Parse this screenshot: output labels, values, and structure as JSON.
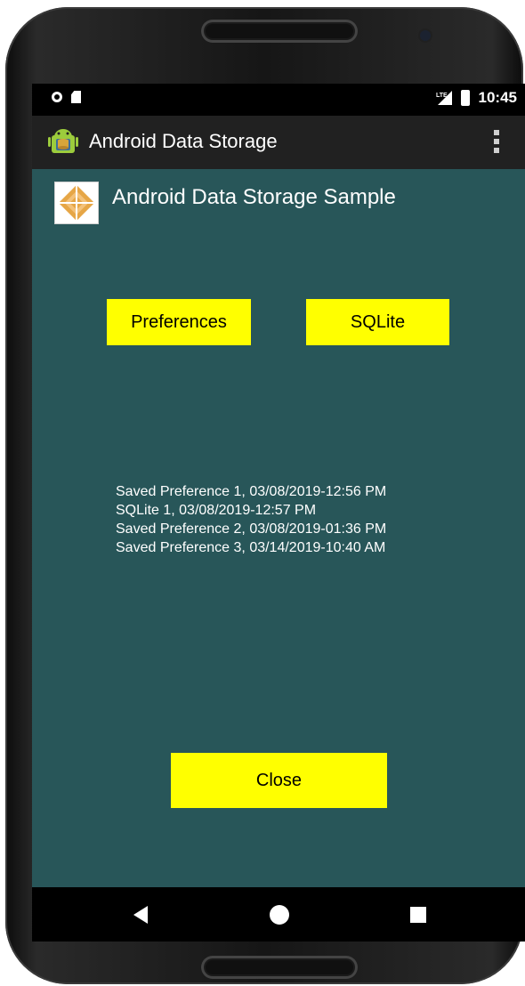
{
  "status_bar": {
    "time": "10:45",
    "network": "LTE"
  },
  "action_bar": {
    "title": "Android Data Storage",
    "icon": "android-robot-icon",
    "menu_icon": "overflow-menu-icon"
  },
  "content": {
    "logo_icon": "diamond-logo-icon",
    "sample_title": "Android Data Storage Sample",
    "buttons": {
      "preferences": "Preferences",
      "sqlite": "SQLite",
      "close": "Close"
    },
    "history": [
      "Saved Preference 1, 03/08/2019-12:56 PM",
      "SQLite 1, 03/08/2019-12:57 PM",
      "Saved Preference 2, 03/08/2019-01:36 PM",
      "Saved Preference 3, 03/14/2019-10:40 AM"
    ]
  },
  "colors": {
    "background": "#285659",
    "action_bar": "#212121",
    "button": "#ffff00"
  }
}
